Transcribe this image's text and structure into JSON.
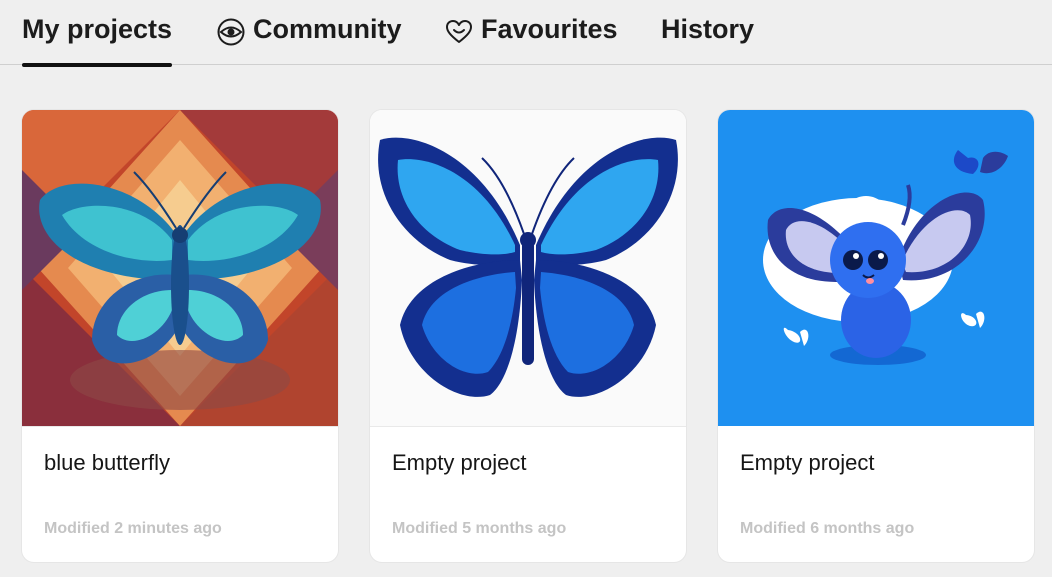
{
  "tabs": [
    {
      "label": "My projects",
      "icon": "none",
      "active": true
    },
    {
      "label": "Community",
      "icon": "eye-icon",
      "active": false
    },
    {
      "label": "Favourites",
      "icon": "heart-icon",
      "active": false
    },
    {
      "label": "History",
      "icon": "none",
      "active": false
    }
  ],
  "projects": [
    {
      "title": "blue butterfly",
      "modified": "Modified 2 minutes ago",
      "thumbnail": "geometric-butterfly-image"
    },
    {
      "title": "Empty project",
      "modified": "Modified 5 months ago",
      "thumbnail": "blue-butterfly-image"
    },
    {
      "title": "Empty project",
      "modified": "Modified 6 months ago",
      "thumbnail": "cartoon-butterfly-image"
    }
  ],
  "colors": {
    "background": "#efefef",
    "active_underline": "#111111",
    "meta_text": "#c4c4c4",
    "accent_blue": "#1e90f0"
  }
}
